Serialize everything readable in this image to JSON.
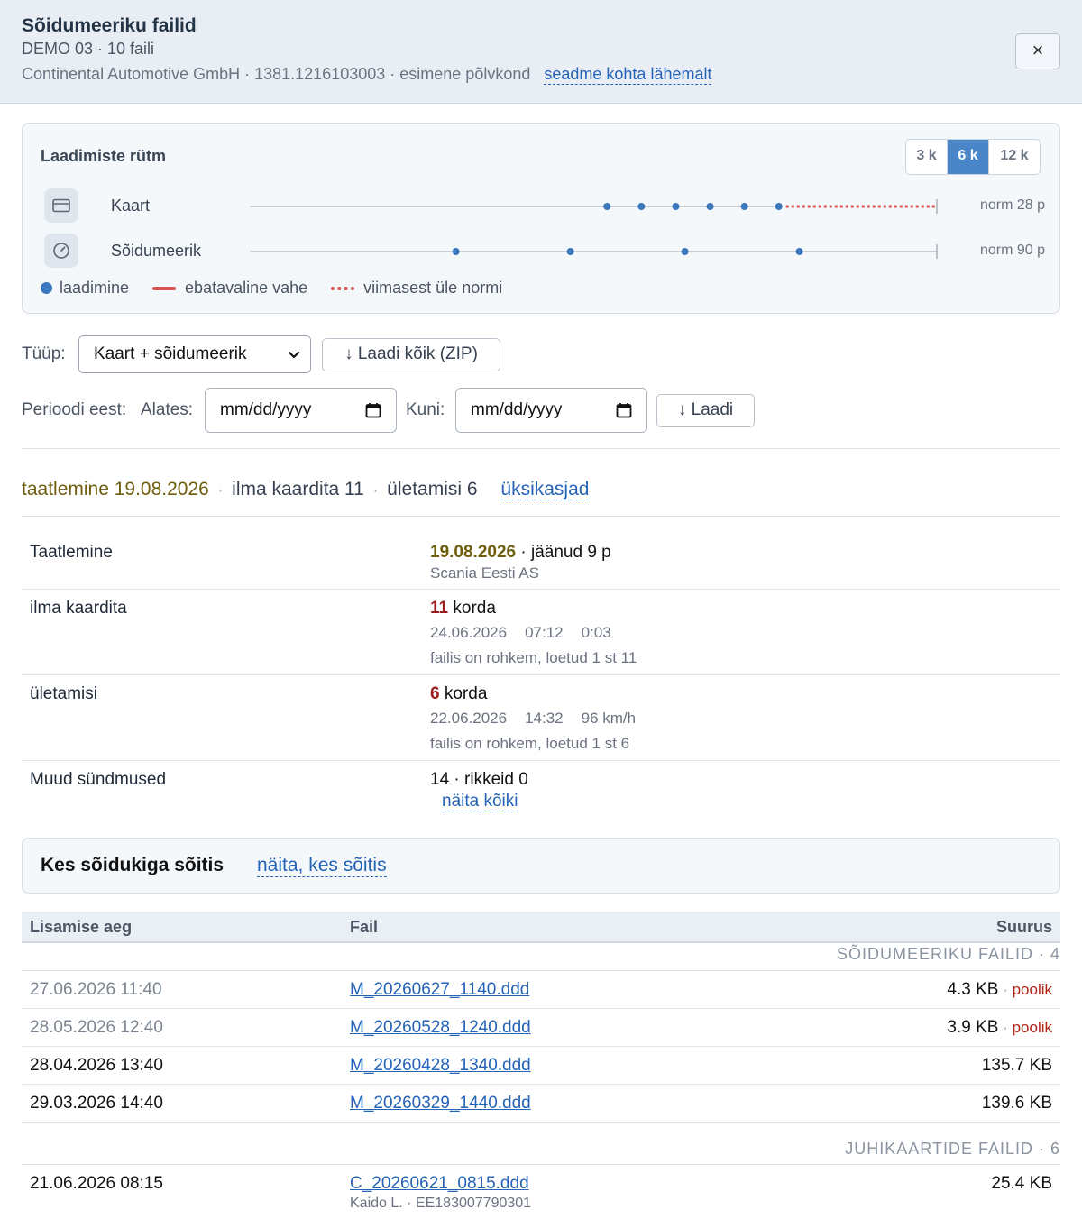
{
  "header": {
    "title": "Sõidumeeriku failid",
    "subtitle": "DEMO 03 · 10 faili",
    "meta": "Continental Automotive GmbH · 1381.1216103003 · esimene põlvkond",
    "device_link": "seadme kohta lähemalt",
    "close_label": "×"
  },
  "rhythm": {
    "title": "Laadimiste rütm",
    "ranges": [
      "3 k",
      "6 k",
      "12 k"
    ],
    "selected_range": "6 k",
    "rows": [
      {
        "label": "Kaart",
        "norm": "norm 28 p",
        "icon": "card-icon",
        "points": [
          0.52,
          0.57,
          0.62,
          0.67,
          0.72,
          0.77
        ],
        "overdue_from": 0.77
      },
      {
        "label": "Sõidumeerik",
        "norm": "norm 90 p",
        "icon": "gauge-icon",
        "points": [
          0.3,
          0.4667,
          0.6333,
          0.8
        ],
        "overdue_from": null
      }
    ],
    "legend": {
      "upload": "laadimine",
      "gap": "ebatavaline vahe",
      "overdue": "viimasest üle normi"
    },
    "colors": {
      "dot": "#3a78bd",
      "overdue": "#d9534f",
      "track": "#c7ced6"
    }
  },
  "filters": {
    "type_label": "Tüüp:",
    "type_value": "Kaart + sõidumeerik",
    "download_all": "↓ Laadi kõik (ZIP)",
    "period_label": "Perioodi eest:",
    "from_label": "Alates:",
    "from_placeholder": "mm/dd/yyyy",
    "to_label": "Kuni:",
    "to_placeholder": "mm/dd/yyyy",
    "download": "↓ Laadi"
  },
  "summary": {
    "calibration": "taatlemine 19.08.2026",
    "no_card": "ilma kaardita 11",
    "overspeed": "ületamisi 6",
    "details_link": "üksikasjad"
  },
  "details": {
    "calibration": {
      "key": "Taatlemine",
      "date": "19.08.2026",
      "remaining": " · jäänud 9 p",
      "company": "Scania Eesti AS"
    },
    "no_card": {
      "key": "ilma kaardita",
      "count": "11",
      "unit": " korda",
      "date": "24.06.2026",
      "time": "07:12",
      "duration": "0:03",
      "note": "failis on rohkem, loetud 1 st 11"
    },
    "overspeed": {
      "key": "ületamisi",
      "count": "6",
      "unit": " korda",
      "date": "22.06.2026",
      "time": "14:32",
      "speed": "96 km/h",
      "note": "failis on rohkem, loetud 1 st 6"
    },
    "other": {
      "key": "Muud sündmused",
      "value": "14 · rikkeid 0",
      "link": "näita kõiki"
    }
  },
  "drivers": {
    "title": "Kes sõidukiga sõitis",
    "link": "näita, kes sõitis"
  },
  "files": {
    "columns": [
      "Lisamise aeg",
      "Fail",
      "Suurus"
    ],
    "groups": [
      {
        "title": "SÕIDUMEERIKU FAILID · 4",
        "rows": [
          {
            "time": "27.06.2026 11:40",
            "name": "M_20260627_1140.ddd",
            "size": "4.3 KB",
            "flag": "poolik"
          },
          {
            "time": "28.05.2026 12:40",
            "name": "M_20260528_1240.ddd",
            "size": "3.9 KB",
            "flag": "poolik"
          },
          {
            "time": "28.04.2026 13:40",
            "name": "M_20260428_1340.ddd",
            "size": "135.7 KB",
            "flag": ""
          },
          {
            "time": "29.03.2026 14:40",
            "name": "M_20260329_1440.ddd",
            "size": "139.6 KB",
            "flag": ""
          }
        ]
      },
      {
        "title": "JUHIKAARTIDE FAILID · 6",
        "rows": [
          {
            "time": "21.06.2026 08:15",
            "name": "C_20260621_0815.ddd",
            "size": "25.4 KB",
            "flag": "",
            "extra": "Kaido L. · EE183007790301"
          }
        ]
      }
    ]
  }
}
